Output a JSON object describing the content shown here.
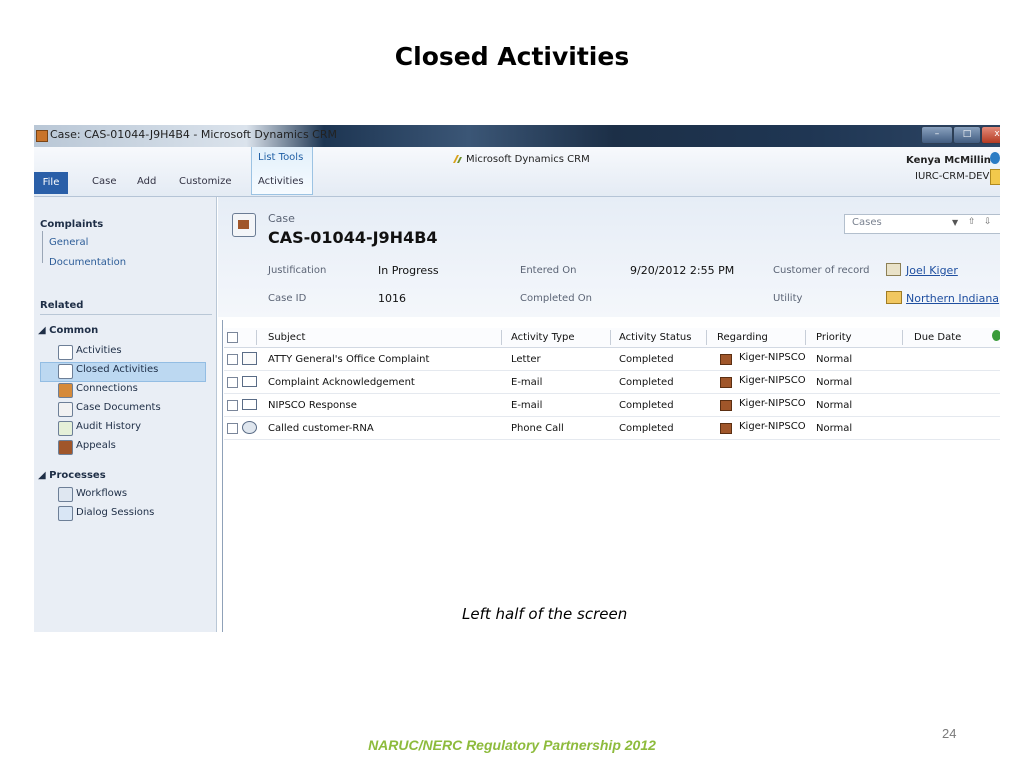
{
  "slide": {
    "title": "Closed Activities",
    "caption": "Left half of the screen",
    "footer": "NARUC/NERC Regulatory Partnership 2012",
    "page_number": "24"
  },
  "window": {
    "title": "Case: CAS-01044-J9H4B4 - Microsoft Dynamics CRM"
  },
  "ribbon": {
    "file": "File",
    "tabs": [
      "Case",
      "Add",
      "Customize"
    ],
    "list_tools": "List Tools",
    "activities": "Activities",
    "brand": "Microsoft Dynamics CRM",
    "user": "Kenya McMillin",
    "org": "IURC-CRM-DEV"
  },
  "nav": {
    "entity": "Complaints",
    "entity_items": [
      "General",
      "Documentation"
    ],
    "related": "Related",
    "common": "Common",
    "common_items": [
      "Activities",
      "Closed Activities",
      "Connections",
      "Case Documents",
      "Audit History",
      "Appeals"
    ],
    "processes": "Processes",
    "process_items": [
      "Workflows",
      "Dialog Sessions"
    ]
  },
  "record": {
    "type": "Case",
    "id": "CAS-01044-J9H4B4",
    "view_selector": "Cases",
    "fields": {
      "justification_label": "Justification",
      "justification_value": "In Progress",
      "entered_on_label": "Entered On",
      "entered_on_value": "9/20/2012 2:55 PM",
      "customer_label": "Customer of record",
      "customer_value": "Joel Kiger",
      "case_id_label": "Case ID",
      "case_id_value": "1016",
      "completed_on_label": "Completed On",
      "utility_label": "Utility",
      "utility_value": "Northern Indiana"
    }
  },
  "grid": {
    "columns": [
      "Subject",
      "Activity Type",
      "Activity Status",
      "Regarding",
      "Priority",
      "Due Date"
    ],
    "rows": [
      {
        "subject": "ATTY General's Office Complaint",
        "type": "Letter",
        "status": "Completed",
        "regarding": "Kiger-NIPSCO",
        "priority": "Normal",
        "icon": "letter-icon"
      },
      {
        "subject": "Complaint Acknowledgement",
        "type": "E-mail",
        "status": "Completed",
        "regarding": "Kiger-NIPSCO",
        "priority": "Normal",
        "icon": "email-icon"
      },
      {
        "subject": "NIPSCO Response",
        "type": "E-mail",
        "status": "Completed",
        "regarding": "Kiger-NIPSCO",
        "priority": "Normal",
        "icon": "email-icon"
      },
      {
        "subject": "Called customer-RNA",
        "type": "Phone Call",
        "status": "Completed",
        "regarding": "Kiger-NIPSCO",
        "priority": "Normal",
        "icon": "phone-icon"
      }
    ]
  },
  "colors": {
    "footer": "#8dbb3c",
    "link": "#1f4fa0",
    "file_tab": "#2a5fa8",
    "selected_nav": "#bcd8f1"
  }
}
